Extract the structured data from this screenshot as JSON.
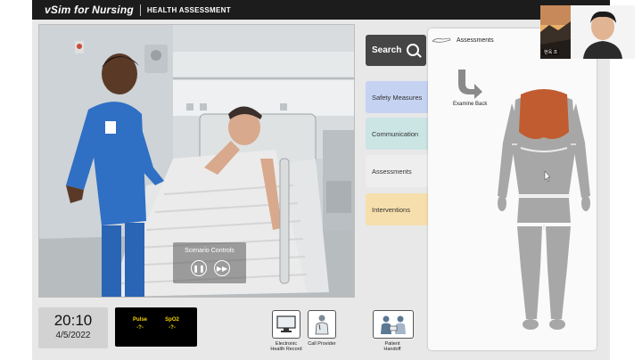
{
  "header": {
    "brand": "vSim for Nursing",
    "module": "HEALTH ASSESSMENT"
  },
  "scenario_controls": {
    "title": "Scenario Controls",
    "pause_icon": "pause-icon",
    "fast_forward_icon": "fast-forward-icon"
  },
  "search": {
    "label": "Search"
  },
  "tabs": [
    {
      "label": "Safety Measures",
      "color": "#c5d2f2"
    },
    {
      "label": "Communication",
      "color": "#cbe4e4"
    },
    {
      "label": "Assessments",
      "color": "#eeeeee"
    },
    {
      "label": "Interventions",
      "color": "#f7dfad"
    }
  ],
  "assessments_panel": {
    "title": "Assessments",
    "examine_label": "Examine Back",
    "highlight_color": "#c05c30"
  },
  "clock": {
    "time": "20:10",
    "date": "4/5/2022"
  },
  "vitals": [
    {
      "label": "Pulse",
      "value": "-?-"
    },
    {
      "label": "SpO2",
      "value": "-?-"
    }
  ],
  "tools": [
    {
      "label_line1": "Electronic",
      "label_line2": "Health Record"
    },
    {
      "label_line1": "Call Provider",
      "label_line2": ""
    },
    {
      "label_line1": "Patient",
      "label_line2": "Handoff"
    }
  ],
  "webcam": {
    "name": "현욱 조"
  }
}
